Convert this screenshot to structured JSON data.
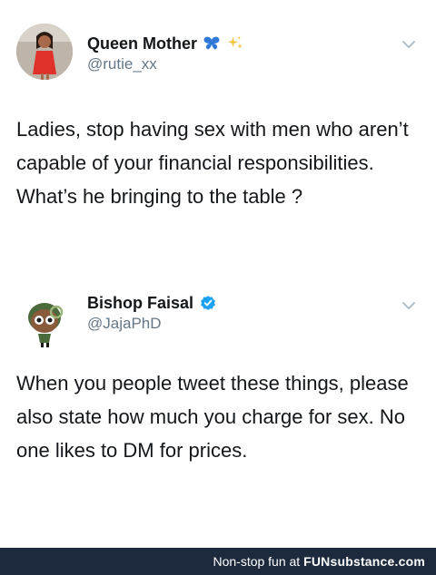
{
  "tweets": [
    {
      "name": "Queen Mother",
      "handle": "@rutie_xx",
      "name_icons": [
        "butterfly-icon",
        "sparkles-icon"
      ],
      "text": "Ladies, stop having sex with men who aren’t capable of your financial responsibilities. What’s he bringing to the table ?"
    },
    {
      "name": "Bishop Faisal",
      "handle": "@JajaPhD",
      "name_icons": [
        "verified-badge-icon"
      ],
      "text": "When you people tweet these things, please also state how much you charge for sex. No one likes to DM for prices."
    }
  ],
  "footer": {
    "text": "Non-stop fun at",
    "brand": "FUNsubstance.com"
  },
  "colors": {
    "text": "#14171a",
    "secondary": "#657786",
    "verified": "#1da1f2",
    "footer_bg": "#1d2a3d"
  }
}
